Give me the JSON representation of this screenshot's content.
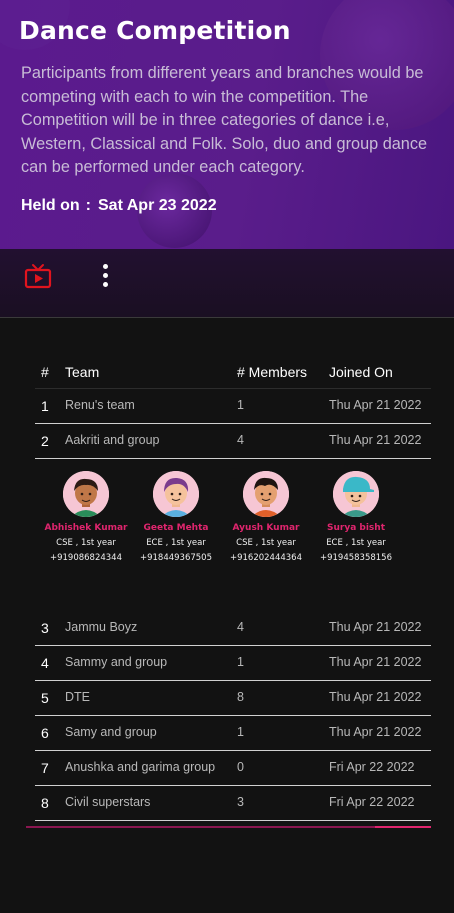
{
  "event": {
    "title": "Dance Competition",
    "description": "Participants from different years and branches would be competing with each to win the competition. The Competition will be in three categories of dance i.e, Western, Classical and Folk. Solo, duo and group dance can be performed under each category.",
    "held_label": "Held on",
    "held_sep": ":",
    "held_date": "Sat Apr 23 2022"
  },
  "toolbar": {
    "tv_icon": "tv-icon",
    "menu_icon": "kebab-menu-icon",
    "accent_color": "#e0141e"
  },
  "table": {
    "headers": [
      "#",
      "Team",
      "# Members",
      "Joined On"
    ],
    "rows": [
      {
        "num": "1",
        "team": "Renu's team",
        "members": "1",
        "joined": "Thu Apr 21 2022"
      },
      {
        "num": "2",
        "team": "Aakriti and group",
        "members": "4",
        "joined": "Thu Apr 21 2022"
      },
      {
        "num": "3",
        "team": "Jammu Boyz",
        "members": "4",
        "joined": "Thu Apr 21 2022"
      },
      {
        "num": "4",
        "team": "Sammy and group",
        "members": "1",
        "joined": "Thu Apr 21 2022"
      },
      {
        "num": "5",
        "team": "DTE",
        "members": "8",
        "joined": "Thu Apr 21 2022"
      },
      {
        "num": "6",
        "team": "Samy and group",
        "members": "1",
        "joined": "Thu Apr 21 2022"
      },
      {
        "num": "7",
        "team": "Anushka and garima group",
        "members": "0",
        "joined": "Fri Apr 22 2022"
      },
      {
        "num": "8",
        "team": "Civil superstars",
        "members": "3",
        "joined": "Fri Apr 22 2022"
      }
    ],
    "expanded_members": [
      {
        "name": "Abhishek Kumar",
        "info": "CSE , 1st year",
        "phone": "+919086824344"
      },
      {
        "name": "Geeta Mehta",
        "info": "ECE , 1st year",
        "phone": "+918449367505"
      },
      {
        "name": "Ayush Kumar",
        "info": "CSE , 1st year",
        "phone": "+916202444364"
      },
      {
        "name": "Surya bisht",
        "info": "ECE , 1st year",
        "phone": "+919458358156"
      }
    ]
  },
  "colors": {
    "hero_purple": "#5b1a8e",
    "member_name": "#e0256e",
    "background": "#121212"
  }
}
